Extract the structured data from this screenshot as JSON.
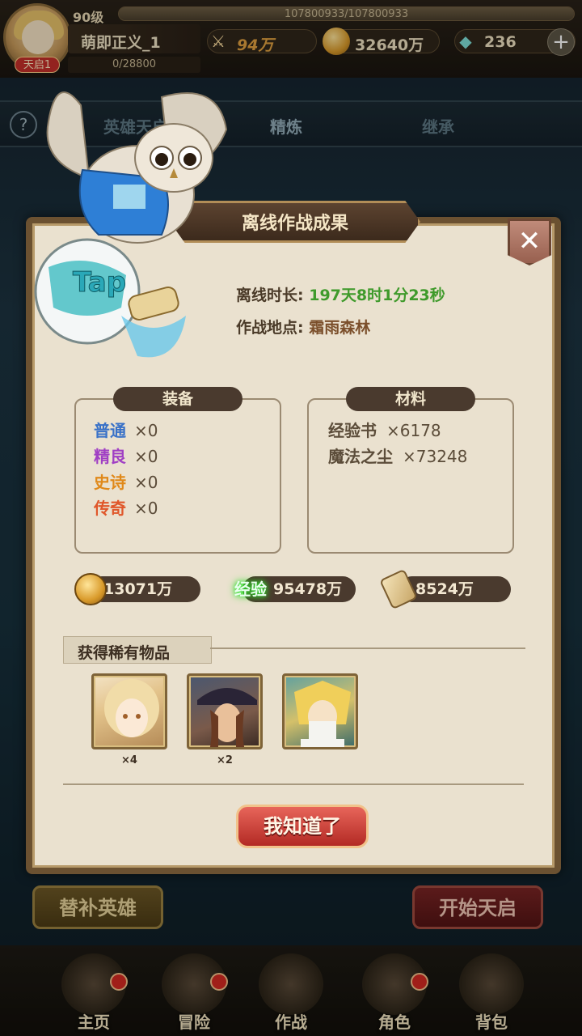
{
  "player": {
    "level": "90级",
    "hp_text": "107800933/107800933",
    "hp_fraction": 1.0,
    "name": "萌即正义_1",
    "badge": "天启1",
    "exp_text": "0/28800"
  },
  "stats": {
    "power": "94万",
    "gold": "32640万",
    "gems": "236"
  },
  "tabs": [
    "英雄天启",
    "精炼",
    "继承"
  ],
  "help_label": "?",
  "dialog": {
    "title": "离线作战成果",
    "duration_label": "离线时长:",
    "duration_value": "197天8时1分23秒",
    "location_label": "作战地点:",
    "location_value": "霜雨森林",
    "equipment": {
      "title": "装备",
      "items": [
        {
          "name": "普通",
          "count": "×0",
          "color": "#3a72c8"
        },
        {
          "name": "精良",
          "count": "×0",
          "color": "#a03fc4"
        },
        {
          "name": "史诗",
          "count": "×0",
          "color": "#e0891a"
        },
        {
          "name": "传奇",
          "count": "×0",
          "color": "#e0572a"
        }
      ]
    },
    "materials": {
      "title": "材料",
      "items": [
        {
          "name": "经验书",
          "count": "×6178"
        },
        {
          "name": "魔法之尘",
          "count": "×73248"
        }
      ]
    },
    "rewards": {
      "gold": "13071万",
      "exp_label": "经验",
      "exp": "95478万",
      "scroll": "8524万"
    },
    "rare_title": "获得稀有物品",
    "rare_items": [
      {
        "count": "×4"
      },
      {
        "count": "×2"
      },
      {
        "count": ""
      }
    ],
    "ok_button": "我知道了",
    "close_icon": "close-icon"
  },
  "bottom_buttons": {
    "substitute": "替补英雄",
    "start": "开始天启"
  },
  "nav": [
    "主页",
    "冒险",
    "作战",
    "角色",
    "背包"
  ],
  "mascot_text": "Tap",
  "colors": {
    "dialog_bg": "#eae1cf",
    "frame": "#6b5131",
    "green_text": "#3f9a2b",
    "ok_red": "#b32a24"
  }
}
